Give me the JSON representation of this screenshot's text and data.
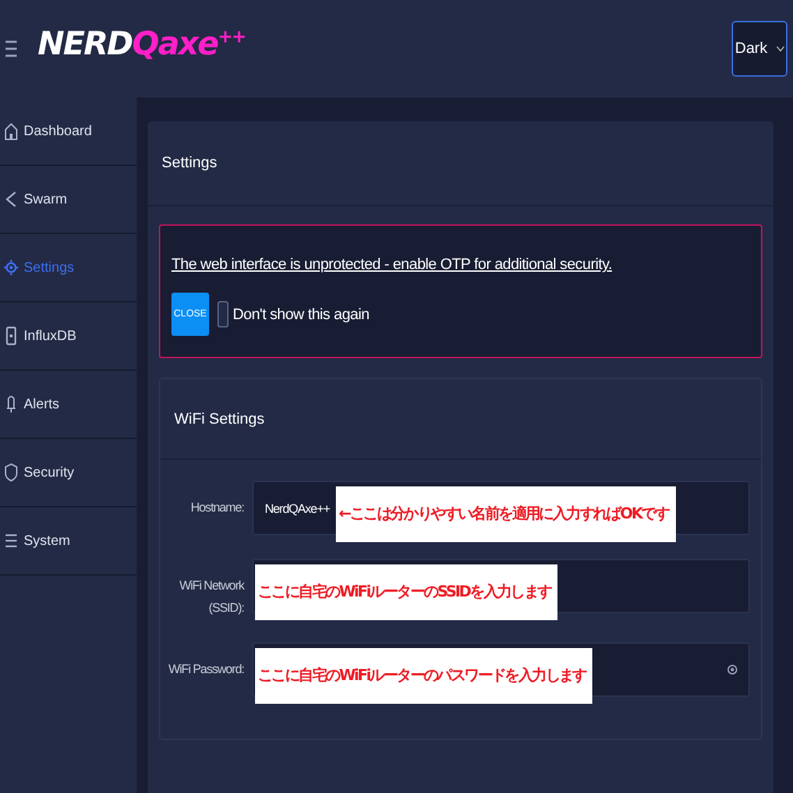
{
  "header": {
    "logo": {
      "primary": "NERD",
      "accent": "Qaxe",
      "superscript": "++"
    },
    "theme_select": {
      "value": "Dark"
    }
  },
  "sidebar": {
    "items": [
      {
        "label": "Dashboard",
        "selected": false
      },
      {
        "label": "Swarm",
        "selected": false
      },
      {
        "label": "Settings",
        "selected": true
      },
      {
        "label": "InfluxDB",
        "selected": false
      },
      {
        "label": "Alerts",
        "selected": false
      },
      {
        "label": "Security",
        "selected": false
      },
      {
        "label": "System",
        "selected": false
      }
    ]
  },
  "page_title": "Settings",
  "alert": {
    "message": "The web interface is unprotected - enable OTP for additional security.",
    "close_button": "CLOSE",
    "checkbox": {
      "label": "Don't show this again",
      "checked": false
    }
  },
  "wifi_card": {
    "title": "WiFi Settings",
    "fields": [
      {
        "label": "Hostname:",
        "value": "NerdQAxe++",
        "kind": "text",
        "annotation": "←ここは分かりやすい名前を適用に入力すればOKです"
      },
      {
        "label": "WiFi Network (SSID):",
        "kind": "text",
        "annotation": "ここに自宅のWiFiルーターのSSIDを入力します"
      },
      {
        "label": "WiFi Password:",
        "kind": "password",
        "annotation": "ここに自宅のWiFiルーターのパスワードを入力します"
      }
    ]
  }
}
